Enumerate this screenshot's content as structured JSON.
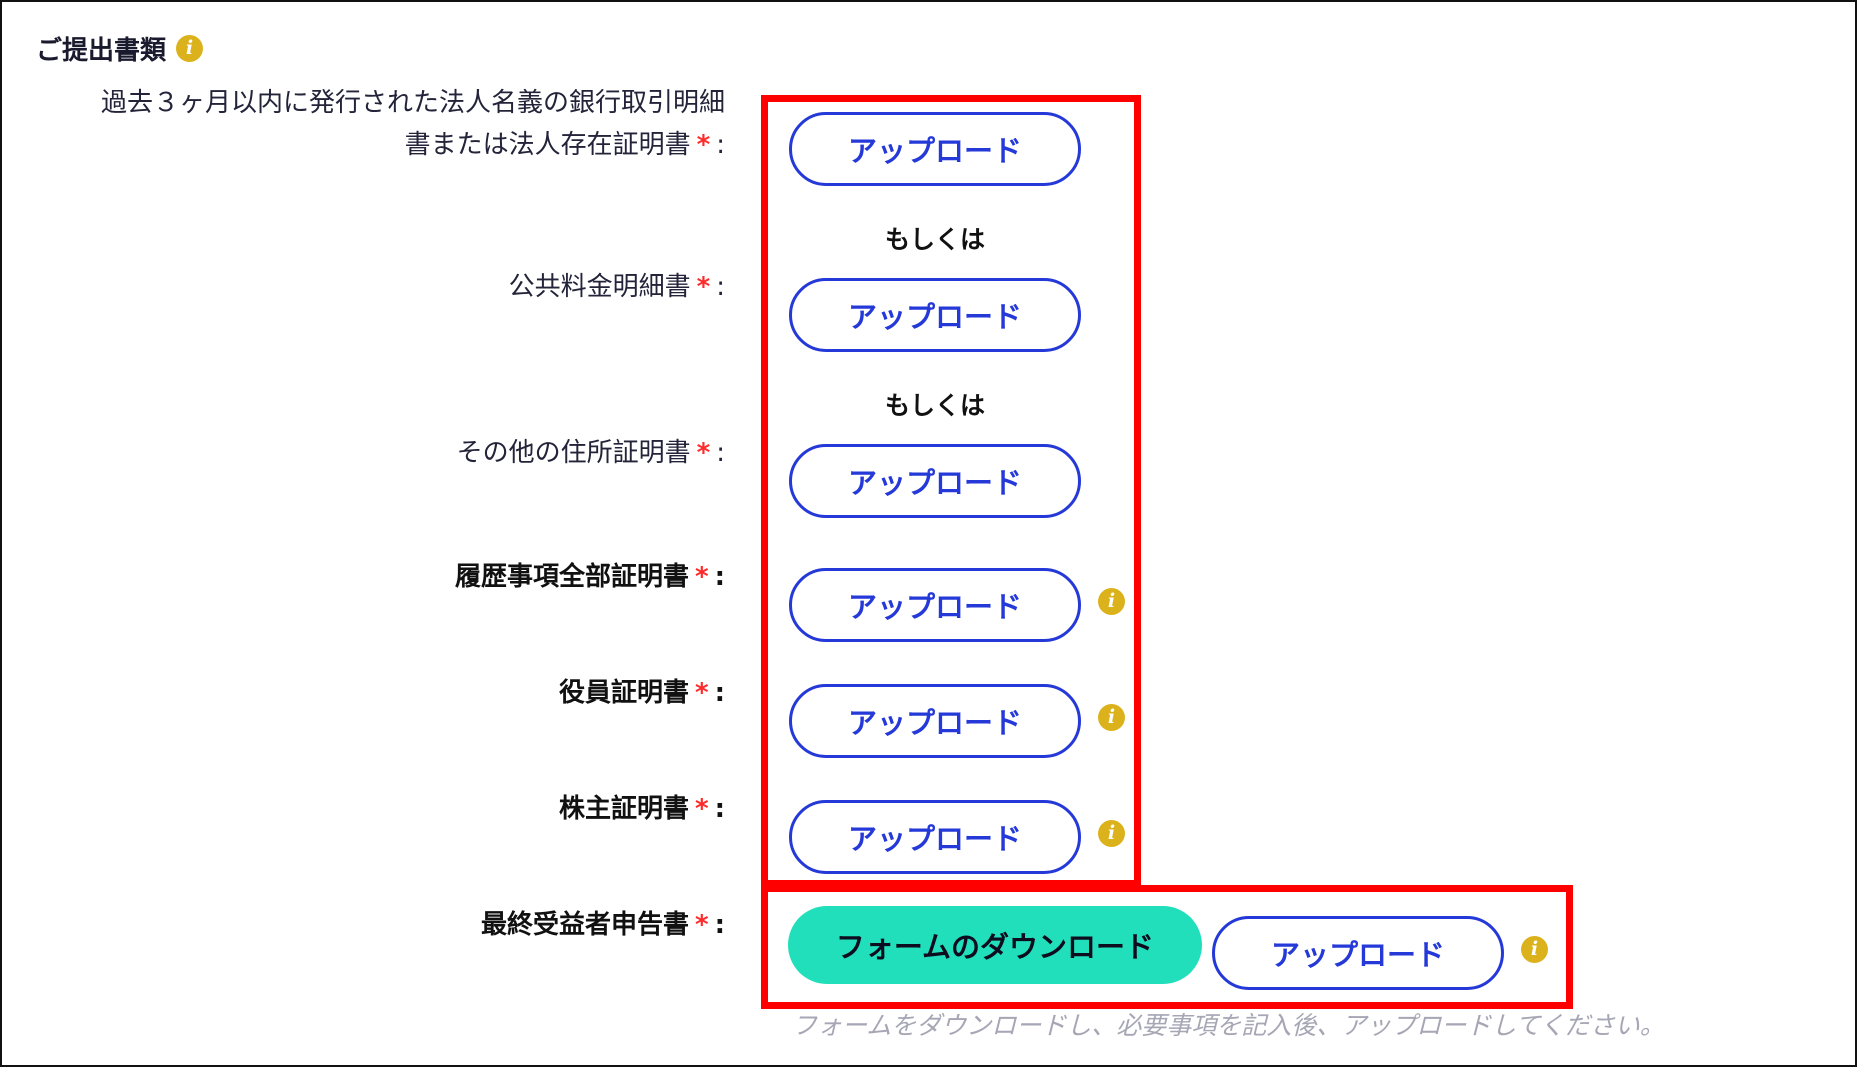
{
  "section": {
    "title": "ご提出書類"
  },
  "documents": [
    {
      "label": "過去３ヶ月以内に発行された法人名義の銀行取引明細書または法人存在証明書",
      "required_mark": "*",
      "colon": ":"
    },
    {
      "label": "公共料金明細書",
      "required_mark": "*",
      "colon": ":"
    },
    {
      "label": "その他の住所証明書",
      "required_mark": "*",
      "colon": ":"
    },
    {
      "label": "履歴事項全部証明書",
      "required_mark": "*",
      "colon": ":"
    },
    {
      "label": "役員証明書",
      "required_mark": "*",
      "colon": ":"
    },
    {
      "label": "株主証明書",
      "required_mark": "*",
      "colon": ":"
    },
    {
      "label": "最終受益者申告書",
      "required_mark": "*",
      "colon": ":"
    }
  ],
  "label_lines": {
    "line1": "過去３ヶ月以内に発行された法人名義の銀行取引明細",
    "line2": "書または法人存在証明書"
  },
  "buttons": {
    "upload_label": "アップロード",
    "download_form_label": "フォームのダウンロード"
  },
  "or_text": "もしくは",
  "hint_text": "フォームをダウンロードし、必要事項を記入後、アップロードしてください。",
  "info_icon_glyph": "i",
  "colors": {
    "accent_blue": "#2539d8",
    "download_green": "#22dfbb",
    "required_red": "#ff2b2b",
    "info_gold": "#dcb21c",
    "highlight_red": "#ff0000",
    "hint_gray": "#a6a6b5"
  }
}
